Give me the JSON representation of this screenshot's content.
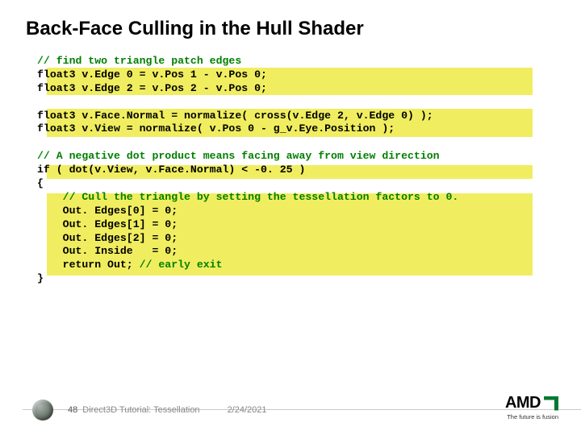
{
  "title": "Back-Face Culling in the Hull Shader",
  "code": {
    "c1": "// find two triangle patch edges",
    "l2": "float3 v.Edge 0 = v.Pos 1 - v.Pos 0;",
    "l3": "float3 v.Edge 2 = v.Pos 2 - v.Pos 0;",
    "l4": "float3 v.Face.Normal = normalize( cross(v.Edge 2, v.Edge 0) );",
    "l5": "float3 v.View = normalize( v.Pos 0 - g_v.Eye.Position );",
    "c2": "// A negative dot product means facing away from view direction",
    "l7": "if ( dot(v.View, v.Face.Normal) < -0. 25 )",
    "l8": "{",
    "c3": "    // Cull the triangle by setting the tessellation factors to 0.",
    "l10": "    Out. Edges[0] = 0;",
    "l11": "    Out. Edges[1] = 0;",
    "l12": "    Out. Edges[2] = 0;",
    "l13": "    Out. Inside   = 0;",
    "l14a": "    return Out; ",
    "c4": "// early exit",
    "l15": "}"
  },
  "footer": {
    "page": "48",
    "doc": "Direct3D Tutorial: Tessellation",
    "date": "2/24/2021"
  },
  "logo": {
    "brand": "AMD",
    "tagline": "The future is fusion"
  }
}
